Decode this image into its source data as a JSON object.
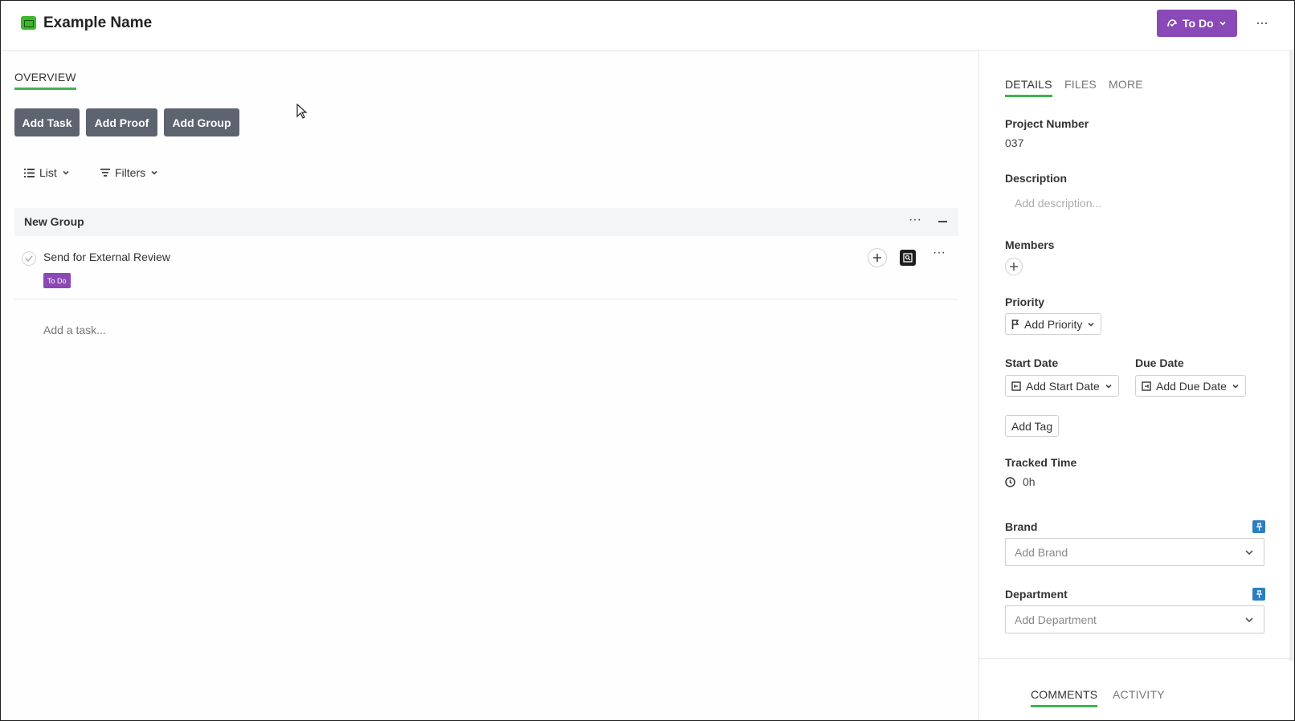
{
  "header": {
    "title": "Example Name",
    "status_label": "To Do",
    "more_label": "···"
  },
  "main": {
    "overview_tab": "OVERVIEW",
    "actions": {
      "add_task": "Add Task",
      "add_proof": "Add Proof",
      "add_group": "Add Group"
    },
    "view": {
      "list_label": "List",
      "filters_label": "Filters"
    },
    "group": {
      "name": "New Group",
      "more_label": "···"
    },
    "tasks": [
      {
        "name": "Send for External Review",
        "status": "To Do"
      }
    ],
    "task_more_label": "···",
    "add_task_placeholder": "Add a task..."
  },
  "details": {
    "tabs": [
      "DETAILS",
      "FILES",
      "MORE"
    ],
    "project_number_label": "Project Number",
    "project_number": "037",
    "description_label": "Description",
    "description_placeholder": "Add description...",
    "members_label": "Members",
    "priority_label": "Priority",
    "priority_button": "Add Priority",
    "start_date_label": "Start Date",
    "start_date_button": "Add Start Date",
    "due_date_label": "Due Date",
    "due_date_button": "Add Due Date",
    "tag_button": "Add Tag",
    "tracked_time_label": "Tracked Time",
    "tracked_time": "0h",
    "brand_label": "Brand",
    "brand_placeholder": "Add Brand",
    "department_label": "Department",
    "department_placeholder": "Add Department",
    "bottom_tabs": [
      "COMMENTS",
      "ACTIVITY"
    ]
  },
  "colors": {
    "status_purple": "#8a49b6",
    "accent_green": "#3fb34f",
    "action_gray": "#5d6470",
    "pin_blue": "#2b7fc1"
  }
}
